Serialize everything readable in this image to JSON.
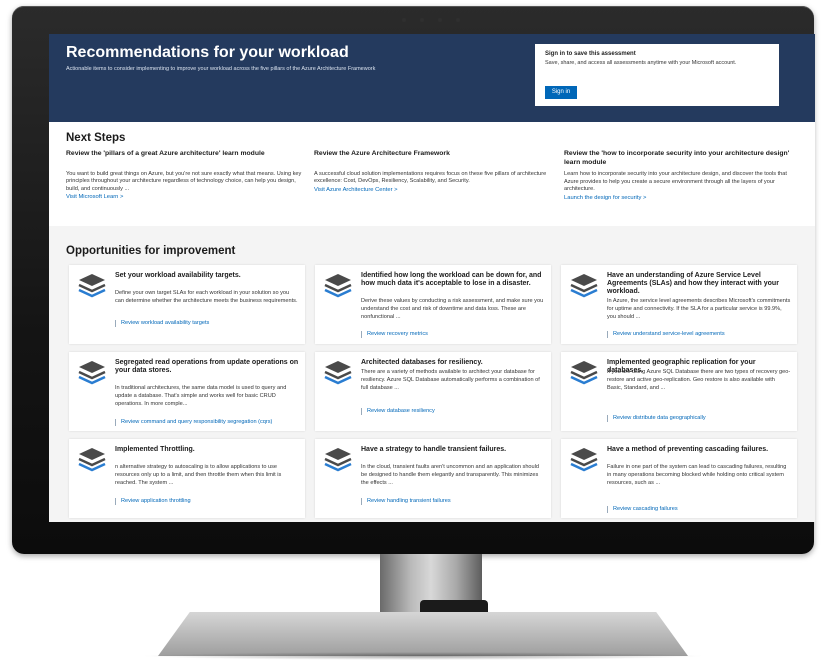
{
  "hero": {
    "title": "Recommendations for your workload",
    "subtitle": "Actionable items to consider implementing to improve your workload across the five pillars of the Azure Architecture Framework",
    "signin_title": "Sign in to save this assessment",
    "signin_desc": "Save, share, and access all assessments anytime with your Microsoft account.",
    "signin_button": "Sign in"
  },
  "next_steps": {
    "title": "Next Steps",
    "items": [
      {
        "heading": "Review the 'pillars of a great Azure architecture' learn module",
        "text": "You want to build great things on Azure, but you're not sure exactly what that means. Using key principles throughout your architecture regardless of technology choice, can help you design, build, and continuously ...",
        "link": "Visit Microsoft Learn  >"
      },
      {
        "heading": "Review the Azure Architecture Framework",
        "text": "A successful cloud solution implementations requires focus on these five pillars of architecture excellence: Cost, DevOps, Resiliency, Scalability, and Security.",
        "link": "Visit Azure Architecture Center  >"
      },
      {
        "heading": "Review the 'how to incorporate security into your architecture design' learn module",
        "text": "Learn how to incorporate security into your architecture design, and discover the tools that Azure provides to help you create a secure environment through all the layers of your architecture.",
        "link": "Launch the design for security  >"
      }
    ]
  },
  "opportunities": {
    "title": "Opportunities for improvement",
    "cards": [
      {
        "title": "Set your workload availability targets.",
        "desc": "Define your own target SLAs for each workload in your solution so you can determine whether the architecture meets the business requirements.",
        "link": "Review workload availability targets"
      },
      {
        "title": "Identified how long the workload can be down for, and how much data it's acceptable to lose in a disaster.",
        "desc": "Derive these values by conducting a risk assessment, and make sure you understand the cost and risk of downtime and data loss. These are nonfunctional ...",
        "link": "Review recovery metrics"
      },
      {
        "title": "Have an understanding of Azure Service Level Agreements (SLAs) and how they interact with your workload.",
        "desc": "In Azure, the service level agreements describes Microsoft's commitments for uptime and connectivity. If the SLA for a particular service is 99.9%, you should ...",
        "link": "Review understand service-level agreements"
      },
      {
        "title": "Segregated read operations from update operations on your data stores.",
        "desc": "In traditional architectures, the same data model is used to query and update a database. That's simple and works well for basic CRUD operations. In more comple...",
        "link": "Review command and query responsibility segregation (cqrs)"
      },
      {
        "title": "Architected databases for resiliency.",
        "desc": "There are a variety of methods available to architect your database for resiliency. Azure SQL Database automatically performs a combination of full database ...",
        "link": "Review database resiliency"
      },
      {
        "title": "Implemented geographic replication for your databases.",
        "desc": "If you are using Azure SQL Database there are two types of recovery geo-restore and active geo-replication. Geo restore is also available with Basic, Standard, and ...",
        "link": "Review distribute data geographically"
      },
      {
        "title": "Implemented Throttling.",
        "desc": "n alternative strategy to autoscaling is to allow applications to use resources only up to a limit, and then throttle them when this limit is reached. The system ...",
        "link": "Review application throttling"
      },
      {
        "title": "Have a strategy to handle transient failures.",
        "desc": "In the cloud, transient faults aren't uncommon and an application should be designed to handle them elegantly and transparently. This minimizes the effects ...",
        "link": "Review handling transient failures"
      },
      {
        "title": "Have a method of preventing cascading failures.",
        "desc": "Failure in one part of the system can lead to cascading failures, resulting in many operations becoming blocked while holding onto critical system resources, such as ...",
        "link": "Review cascading failures"
      }
    ]
  },
  "colors": {
    "hero_bg": "#243a5e",
    "accent": "#0067b8",
    "icon_dark": "#4a4a4a",
    "icon_blue": "#2a7dd1"
  },
  "icons": {
    "card_icon": "layers-stack-icon"
  }
}
